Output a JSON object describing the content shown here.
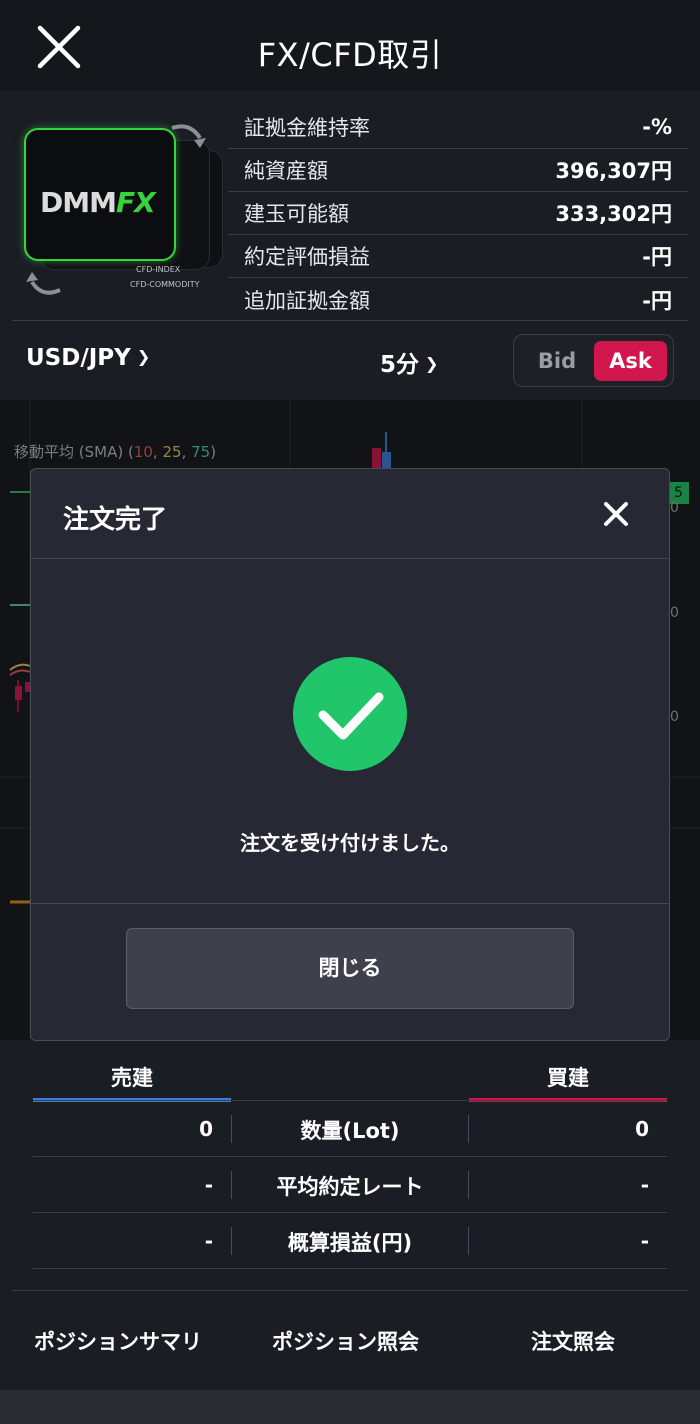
{
  "header": {
    "title": "FX/CFD取引"
  },
  "logo": {
    "brand_dmm": "DMM",
    "brand_fx": "FX",
    "sub1": "CFD-INDEX",
    "sub2": "CFD-COMMODITY"
  },
  "account_info": [
    {
      "label": "証拠金維持率",
      "value": "-%"
    },
    {
      "label": "純資産額",
      "value": "396,307円"
    },
    {
      "label": "建玉可能額",
      "value": "333,302円"
    },
    {
      "label": "約定評価損益",
      "value": "-円"
    },
    {
      "label": "追加証拠金額",
      "value": "-円"
    }
  ],
  "controls": {
    "pair": "USD/JPY",
    "timeframe": "5分",
    "bid_label": "Bid",
    "ask_label": "Ask"
  },
  "chart": {
    "sma_prefix": "移動平均 (SMA) (",
    "sma_10": "10",
    "sma_25": "25",
    "sma_75": "75",
    "sma_sep": ", ",
    "sma_suffix": ")",
    "price_tag": "5",
    "axis_labels": [
      "0",
      "0",
      "0"
    ]
  },
  "modal": {
    "title": "注文完了",
    "message": "注文を受け付けました。",
    "close_button": "閉じる"
  },
  "position_summary": {
    "sell_label": "売建",
    "buy_label": "買建",
    "rows": [
      {
        "sell": "0",
        "label": "数量(Lot)",
        "buy": "0"
      },
      {
        "sell": "-",
        "label": "平均約定レート",
        "buy": "-"
      },
      {
        "sell": "-",
        "label": "概算損益(円)",
        "buy": "-"
      }
    ]
  },
  "bottom_nav": {
    "item1": "ポジションサマリ",
    "item2": "ポジション照会",
    "item3": "注文照会"
  },
  "colors": {
    "accent_ask": "#d1164e",
    "sell_blue": "#3b7fd6",
    "success_green": "#22c66a",
    "brand_green": "#37d33c"
  }
}
